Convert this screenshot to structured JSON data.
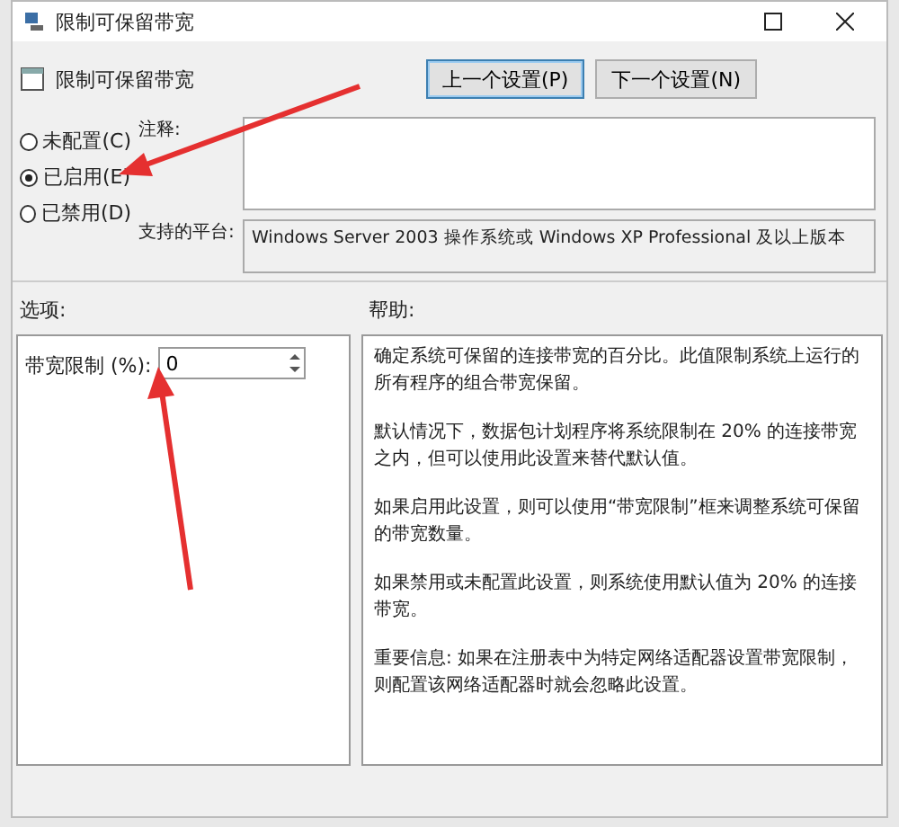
{
  "window": {
    "title": "限制可保留带宽"
  },
  "header": {
    "policy_name": "限制可保留带宽",
    "buttons": [
      {
        "label": "上一个设置(P)",
        "selected": true
      },
      {
        "label": "下一个设置(N)",
        "selected": false
      }
    ]
  },
  "state_options": [
    {
      "label": "未配置(C)",
      "selected": false
    },
    {
      "label": "已启用(E)",
      "selected": true
    },
    {
      "label": "已禁用(D)",
      "selected": false
    }
  ],
  "comment": {
    "label": "注释:"
  },
  "platform": {
    "label": "支持的平台:",
    "value": "Windows Server 2003 操作系统或 Windows XP Professional 及以上版本"
  },
  "options": {
    "heading": "选项:",
    "field_label": "带宽限制 (%):",
    "value": "0"
  },
  "help": {
    "heading": "帮助:",
    "paragraphs": [
      "确定系统可保留的连接带宽的百分比。此值限制系统上运行的所有程序的组合带宽保留。",
      "默认情况下，数据包计划程序将系统限制在 20% 的连接带宽之内，但可以使用此设置来替代默认值。",
      "如果启用此设置，则可以使用“带宽限制”框来调整系统可保留的带宽数量。",
      "如果禁用或未配置此设置，则系统使用默认值为 20% 的连接带宽。",
      "重要信息: 如果在注册表中为特定网络适配器设置带宽限制，则配置该网络适配器时就会忽略此设置。"
    ]
  }
}
